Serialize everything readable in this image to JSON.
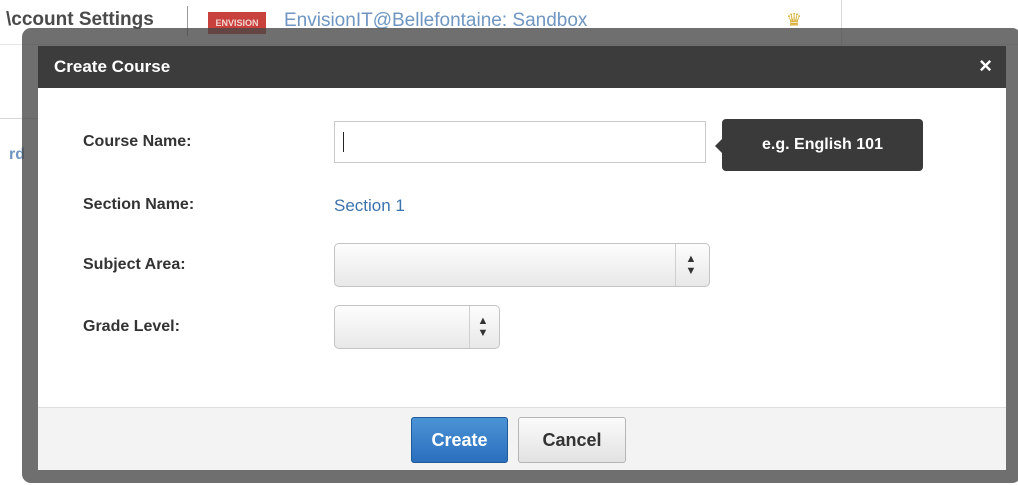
{
  "background": {
    "account_settings": "\\ccount Settings",
    "logo_text": "ENVISION",
    "org_name": "EnvisionIT@Bellefontaine: Sandbox",
    "crown_icon": "crown-icon",
    "left_fragment": "rd"
  },
  "modal": {
    "title": "Create Course",
    "close_glyph": "×",
    "fields": {
      "course_name_label": "Course Name:",
      "course_name_value": "",
      "tooltip": "e.g. English 101",
      "section_name_label": "Section Name:",
      "section_name_value": "Section 1",
      "subject_area_label": "Subject Area:",
      "subject_area_value": "",
      "grade_level_label": "Grade Level:",
      "grade_level_value": ""
    },
    "buttons": {
      "create": "Create",
      "cancel": "Cancel"
    }
  },
  "colors": {
    "header": "#3c3c3c",
    "link": "#3b73ad",
    "primary_button": "#2b6fbd"
  }
}
